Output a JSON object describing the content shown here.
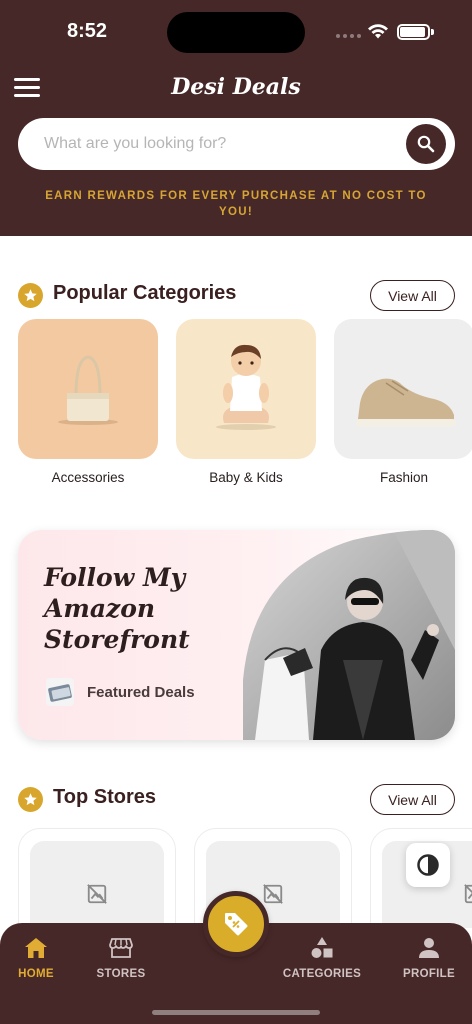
{
  "status_bar": {
    "time": "8:52"
  },
  "header": {
    "title": "Desi Deals",
    "search_placeholder": "What are you looking for?",
    "rewards_text": "EARN REWARDS FOR EVERY PURCHASE AT NO COST TO YOU!"
  },
  "popular_categories": {
    "title": "Popular Categories",
    "view_all": "View All",
    "items": [
      {
        "label": "Accessories",
        "icon": "handbag-image"
      },
      {
        "label": "Baby & Kids",
        "icon": "baby-image"
      },
      {
        "label": "Fashion",
        "icon": "sneaker-image"
      }
    ]
  },
  "banner": {
    "title": "Follow My Amazon Storefront",
    "featured_label": "Featured Deals"
  },
  "top_stores": {
    "title": "Top Stores",
    "view_all": "View All",
    "items": [
      {
        "icon": "image-placeholder-icon"
      },
      {
        "icon": "image-placeholder-icon"
      },
      {
        "icon": "image-placeholder-icon"
      }
    ]
  },
  "bottom_nav": {
    "items": [
      {
        "label": "HOME",
        "icon": "home-icon",
        "active": true
      },
      {
        "label": "STORES",
        "icon": "store-icon",
        "active": false
      },
      {
        "label": "CATEGORIES",
        "icon": "categories-icon",
        "active": false
      },
      {
        "label": "PROFILE",
        "icon": "profile-icon",
        "active": false
      }
    ],
    "center_icon": "deals-tag-icon"
  },
  "colors": {
    "primary": "#472828",
    "accent": "#d9ad2a",
    "background": "#ffffff"
  }
}
